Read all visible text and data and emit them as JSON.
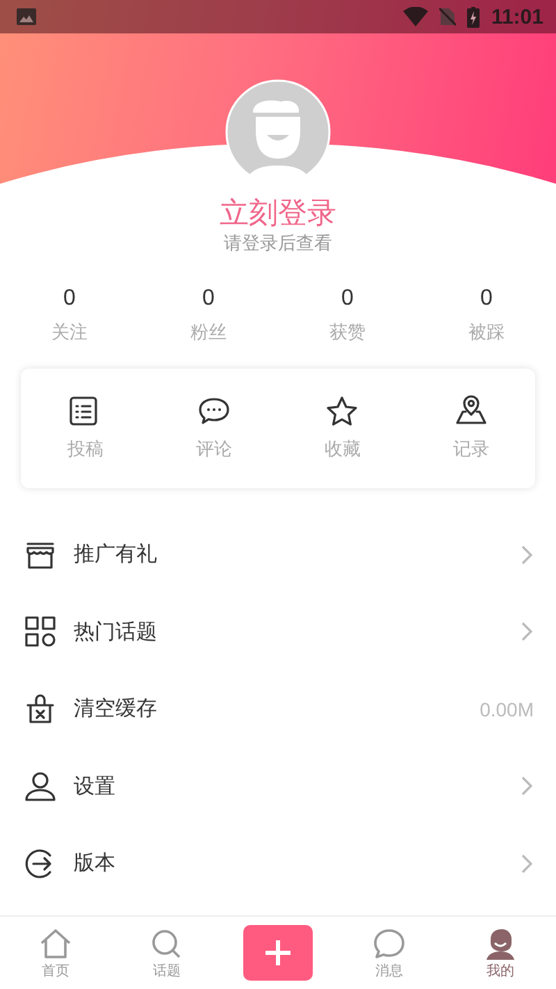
{
  "status_bar": {
    "time": "11:01"
  },
  "profile": {
    "title": "立刻登录",
    "subtitle": "请登录后查看"
  },
  "stats": [
    {
      "value": "0",
      "label": "关注"
    },
    {
      "value": "0",
      "label": "粉丝"
    },
    {
      "value": "0",
      "label": "获赞"
    },
    {
      "value": "0",
      "label": "被踩"
    }
  ],
  "shortcuts": [
    {
      "kind": "list",
      "label": "投稿"
    },
    {
      "kind": "comment",
      "label": "评论"
    },
    {
      "kind": "star",
      "label": "收藏"
    },
    {
      "kind": "location",
      "label": "记录"
    }
  ],
  "menu": [
    {
      "kind": "store",
      "label": "推广有礼"
    },
    {
      "kind": "grid",
      "label": "热门话题"
    },
    {
      "kind": "trash",
      "label": "清空缓存",
      "value": "0.00M"
    },
    {
      "kind": "user",
      "label": "设置"
    },
    {
      "kind": "exit",
      "label": "版本"
    }
  ],
  "bottom_nav": [
    {
      "kind": "home",
      "label": "首页",
      "selected": false
    },
    {
      "kind": "search",
      "label": "话题",
      "selected": false
    },
    {
      "kind": "add",
      "selected": false
    },
    {
      "kind": "message",
      "label": "消息",
      "selected": false
    },
    {
      "kind": "me",
      "label": "我的",
      "selected": true
    }
  ]
}
